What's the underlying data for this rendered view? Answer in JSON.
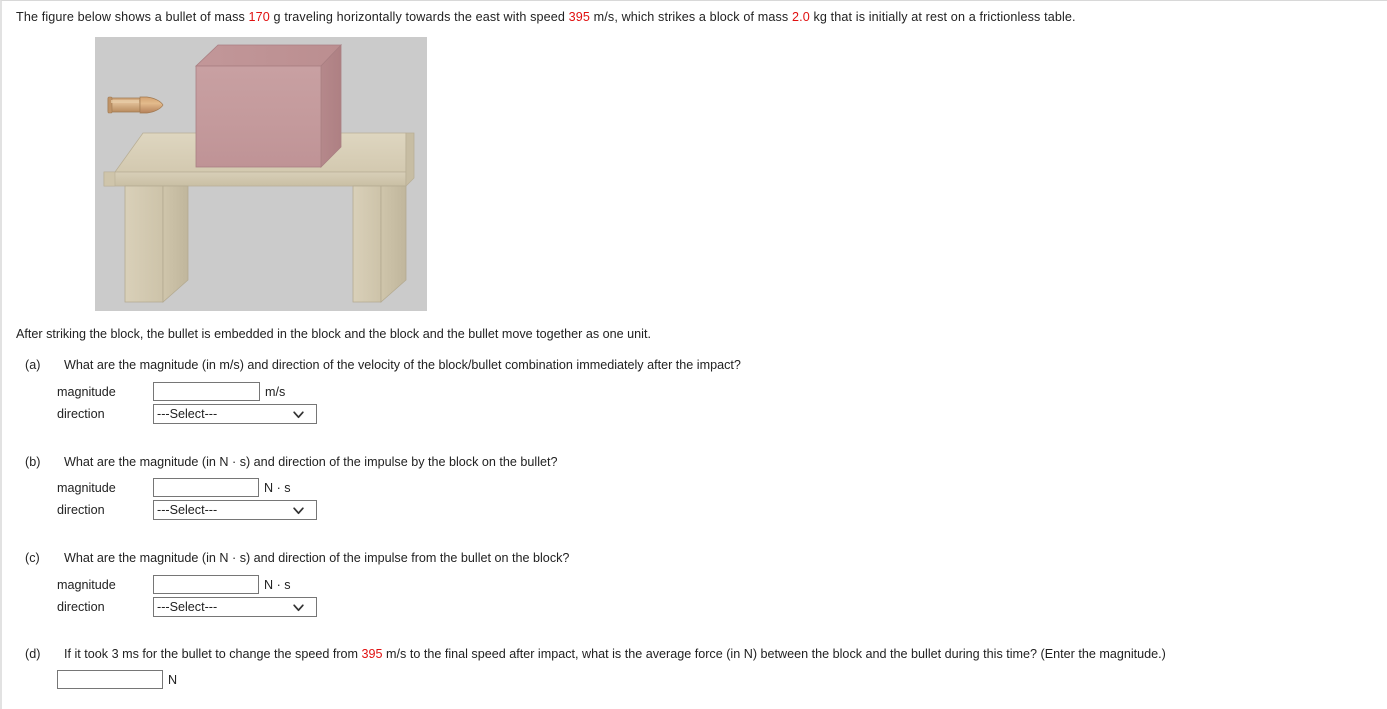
{
  "intro": {
    "seg1": "The figure below shows a bullet of mass ",
    "mass_bullet": "170",
    "seg2": " g traveling horizontally towards the east with speed ",
    "speed": "395",
    "seg3": " m/s, which strikes a block of mass ",
    "mass_block": "2.0",
    "seg4": " kg that is initially at rest on a frictionless table."
  },
  "figure": {
    "alt": "bullet traveling east toward a block resting on a table",
    "background_color": "#cbcbcb",
    "block_color": "#c49a9c",
    "table_color": "#d6cdb4",
    "bullet_color": "#c99a6b"
  },
  "after_text": "After striking the block, the bullet is embedded in the block and the block and the bullet move together as one unit.",
  "labels": {
    "magnitude": "magnitude",
    "direction": "direction",
    "select_placeholder": "---Select---",
    "input_value": ""
  },
  "parts": [
    {
      "label": "(a)",
      "question": "What are the magnitude (in m/s) and direction of the velocity of the block/bullet combination immediately after the impact?",
      "unit": "m/s"
    },
    {
      "label": "(b)",
      "question": "What are the magnitude (in N · s) and direction of the impulse by the block on the bullet?",
      "unit": "N · s"
    },
    {
      "label": "(c)",
      "question": "What are the magnitude (in N · s) and direction of the impulse from the bullet on the block?",
      "unit": "N · s"
    }
  ],
  "part_d": {
    "label": "(d)",
    "q_seg1": "If it took 3 ms for the bullet to change the speed from ",
    "q_speed": "395",
    "q_seg2": " m/s to the final speed after impact, what is the average force (in N) between the block and the bullet during this time? (Enter the magnitude.)",
    "unit": "N"
  },
  "colors": {
    "highlight": "#e01010",
    "text": "#222222",
    "input_border": "#767676"
  }
}
